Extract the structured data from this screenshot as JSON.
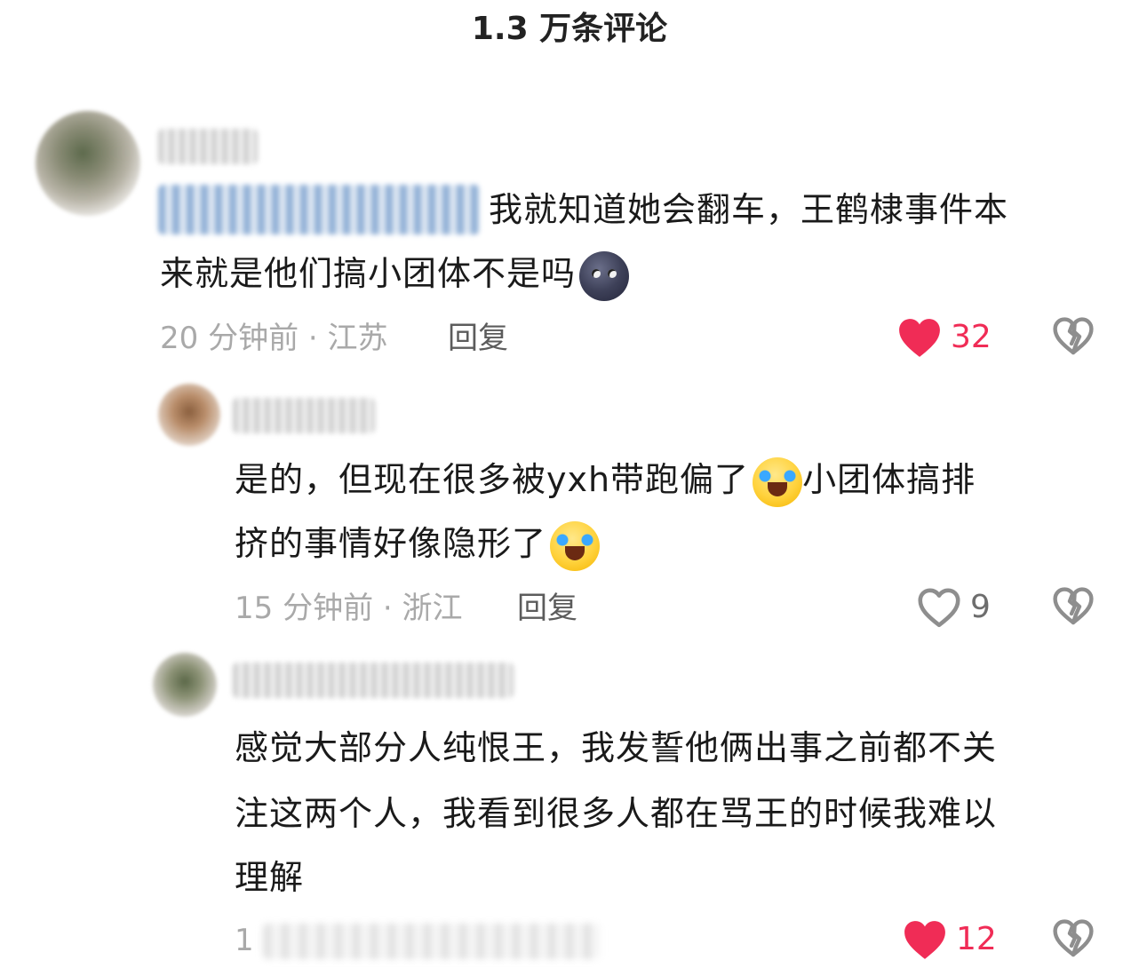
{
  "header": {
    "title": "1.3 万条评论"
  },
  "comments": [
    {
      "text_line1": "我就知道她会翻车，王鹤棣事件本",
      "text_line2": "来就是他们搞小团体不是吗",
      "time_location": "20 分钟前 · 江苏",
      "reply_label": "回复",
      "likes": "32",
      "liked": true,
      "emoji": "new-moon-face-emoji"
    },
    {
      "text_line1": "是的，但现在很多被yxh带跑偏了",
      "text_line1b": "小团体搞排",
      "text_line2": "挤的事情好像隐形了",
      "time_location": "15 分钟前 · 浙江",
      "reply_label": "回复",
      "likes": "9",
      "liked": false,
      "emoji": "crying-face-emoji"
    },
    {
      "text_line1": "感觉大部分人纯恨王，我发誓他俩出事之前都不关",
      "text_line2": "注这两个人，我看到很多人都在骂王的时候我难以",
      "text_line3": "理解",
      "time_location": "1",
      "likes": "12",
      "liked": true
    }
  ],
  "colors": {
    "like_red": "#f02c56",
    "meta_gray": "#a9a9a9",
    "reply_gray": "#5c5c5c"
  },
  "icons": {
    "like": "heart-icon",
    "dislike": "broken-heart-icon"
  }
}
